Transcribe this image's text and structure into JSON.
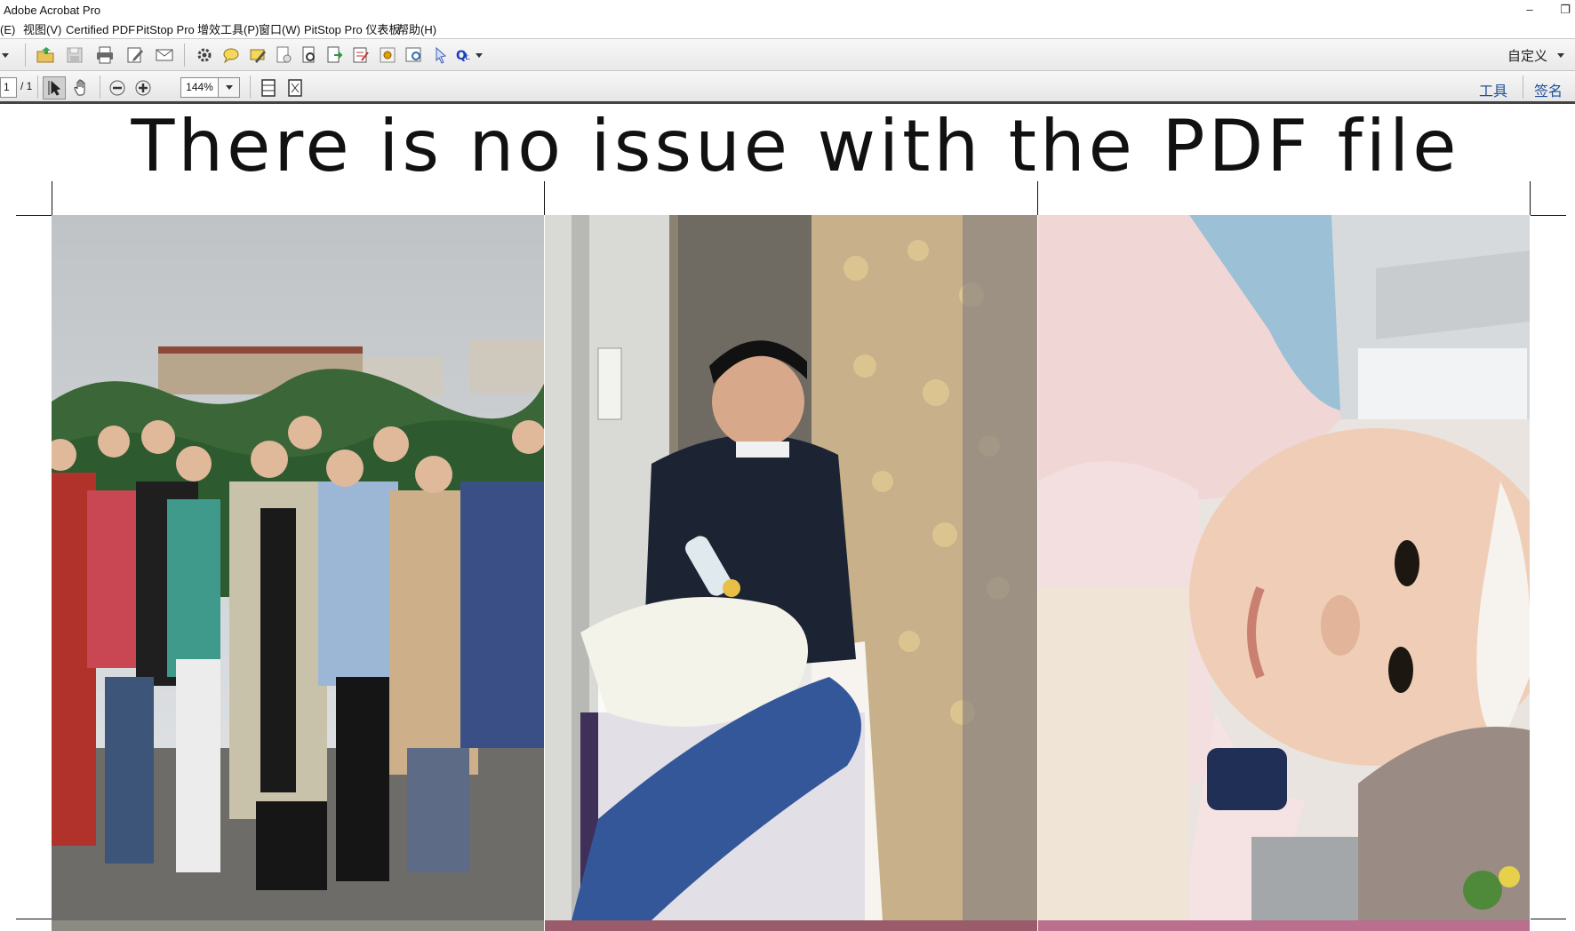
{
  "window": {
    "title": "Adobe Acrobat Pro",
    "minimize": "–",
    "restore": "❐"
  },
  "menu": [
    "(E)",
    "视图(V)",
    "Certified PDF",
    "PitStop Pro",
    "增效工具(P)",
    "窗口(W)",
    "PitStop Pro 仪表板",
    "帮助(H)"
  ],
  "toolbar": {
    "customize_label": "自定义",
    "icons": [
      "open-icon",
      "save-icon",
      "print-icon",
      "edit-icon",
      "email-icon",
      "settings-icon",
      "comment-icon",
      "sign-note-icon",
      "document-icon",
      "preflight-icon",
      "export-icon",
      "form-icon",
      "pitstop-icon",
      "inspect-icon",
      "select-arrow-icon",
      "qi-icon"
    ]
  },
  "nav": {
    "page_current": "1",
    "page_total": "/ 1",
    "zoom": "144%",
    "tools_label": "工具",
    "sign_label": "签名"
  },
  "document": {
    "heading": "There is no issue with the PDF file",
    "photos": [
      {
        "name": "group-photo",
        "description_colors": [
          "#cfd3d6",
          "#3d6a3a",
          "#2b2b2b"
        ]
      },
      {
        "name": "father-feeding-photo",
        "description_colors": [
          "#c9b48a",
          "#1b2536",
          "#3b5c9c"
        ]
      },
      {
        "name": "baby-face-photo",
        "description_colors": [
          "#f1d7cd",
          "#8fb3c9",
          "#e8c4b0"
        ]
      }
    ]
  },
  "colors": {
    "link": "#1d4f9a",
    "toolbar_bottom": "#444444"
  }
}
